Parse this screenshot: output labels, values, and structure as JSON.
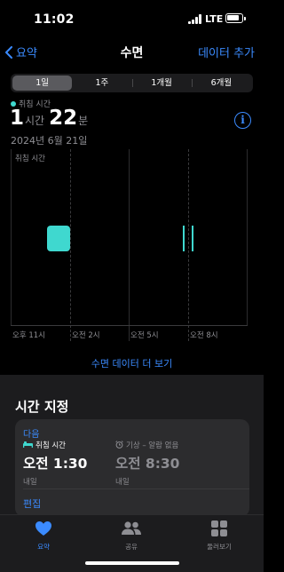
{
  "status_bar": {
    "time": "11:02",
    "network": "LTE"
  },
  "nav": {
    "back_label": "요약",
    "title": "수면",
    "action_label": "데이터 추가"
  },
  "range_tabs": [
    {
      "label": "1일",
      "selected": true
    },
    {
      "label": "1주",
      "selected": false
    },
    {
      "label": "1개월",
      "selected": false
    },
    {
      "label": "6개월",
      "selected": false
    }
  ],
  "summary": {
    "legend": "취침 시간",
    "hours_value": "1",
    "hours_unit": "시간",
    "minutes_value": "22",
    "minutes_unit": "분",
    "date": "2024년 6월 21일",
    "info_icon": "i"
  },
  "chart_data": {
    "type": "bar",
    "series_label": "취침 시간",
    "x_tick_labels": [
      "오후 11시",
      "오전 2시",
      "오전 5시",
      "오전 8시"
    ],
    "segments": [
      {
        "start": "오후 11:55",
        "end": "오전 1:00"
      },
      {
        "start": "오전 6:20",
        "end": "오전 6:25"
      },
      {
        "start": "오전 6:35",
        "end": "오전 6:40"
      }
    ],
    "color": "#3fd8cf"
  },
  "more_link": "수면 데이터 더 보기",
  "schedule": {
    "title": "시간 지정",
    "next_label": "다음",
    "bedtime": {
      "icon": "bed-icon",
      "label": "취침 시간",
      "time": "오전 1:30",
      "day": "내일"
    },
    "wake": {
      "icon": "alarm-icon",
      "label": "기상 – 알람 없음",
      "time": "오전 8:30",
      "day": "내일"
    },
    "edit_label": "편집"
  },
  "tabbar": [
    {
      "icon": "heart-icon",
      "label": "요약",
      "active": true
    },
    {
      "icon": "people-icon",
      "label": "공유",
      "active": false
    },
    {
      "icon": "grid-icon",
      "label": "둘러보기",
      "active": false
    }
  ],
  "colors": {
    "accent": "#3b8bff",
    "sleep": "#3fd8cf"
  }
}
